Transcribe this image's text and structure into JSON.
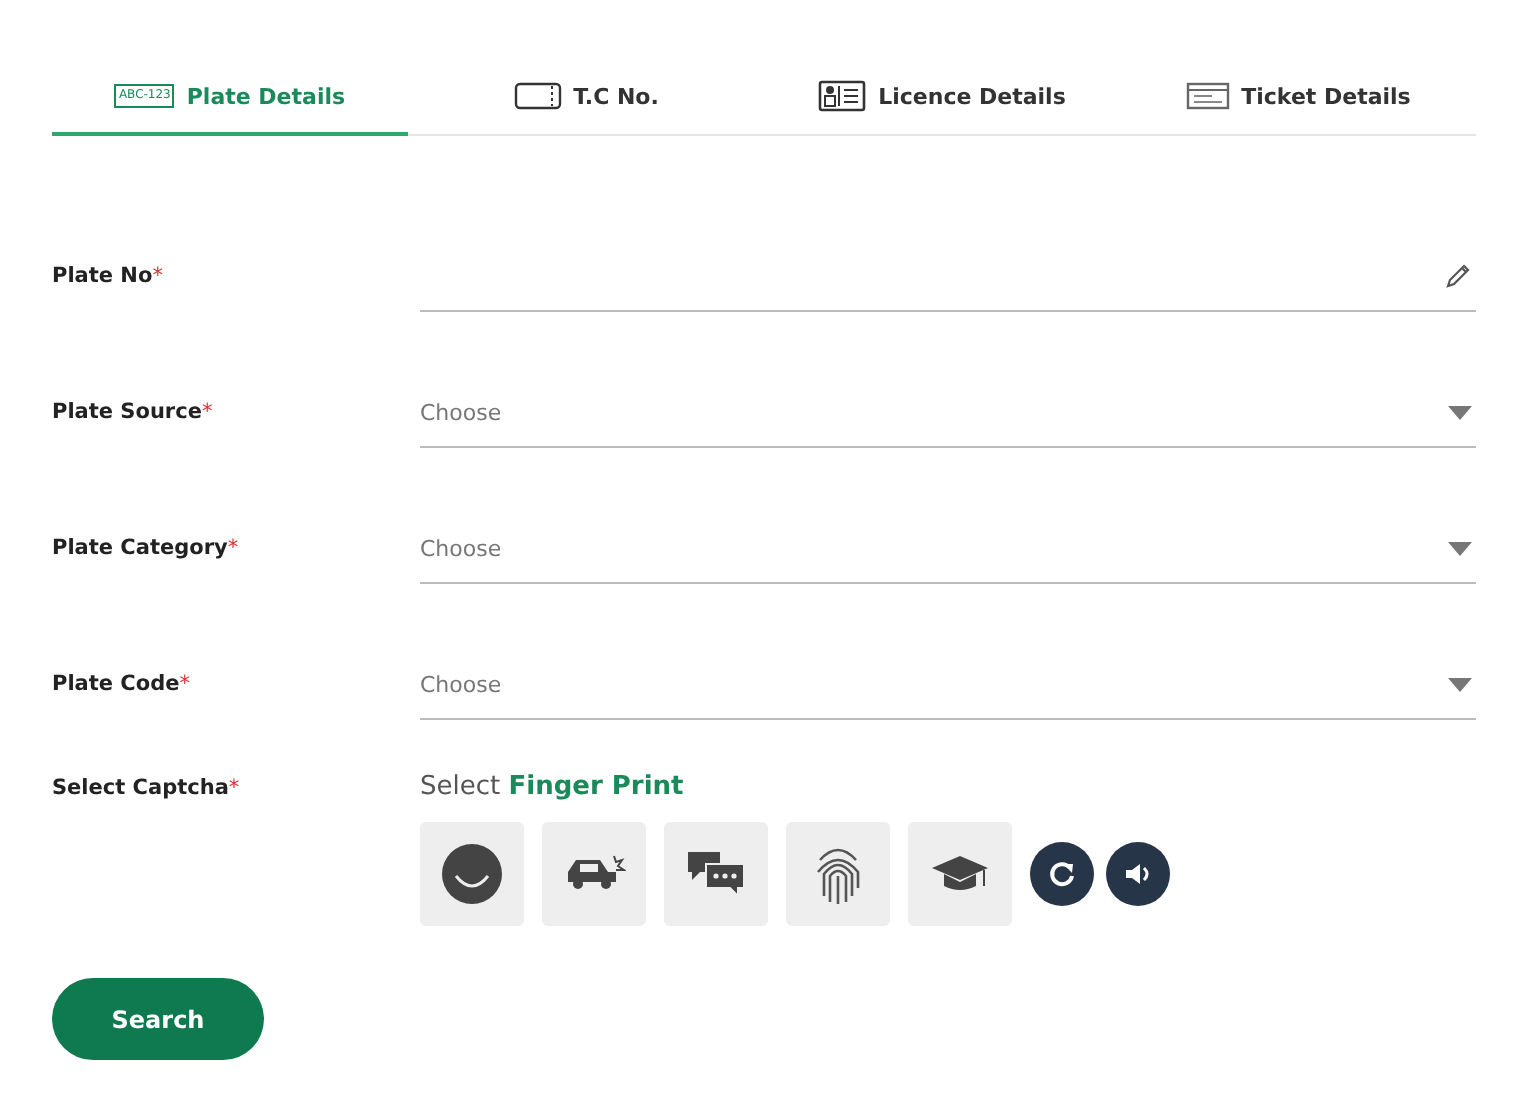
{
  "tabs": [
    {
      "kind": "plate",
      "icon_text": "ABC-123",
      "label": "Plate Details",
      "selected": true
    },
    {
      "kind": "card",
      "label": "T.C No.",
      "selected": false
    },
    {
      "kind": "licence",
      "label": "Licence Details",
      "selected": false
    },
    {
      "kind": "ticket",
      "label": "Ticket Details",
      "selected": false
    }
  ],
  "fields": [
    {
      "kind": "text",
      "label": "Plate No",
      "required_mark": "*"
    },
    {
      "kind": "select",
      "label": "Plate Source",
      "required_mark": "*",
      "placeholder": "Choose"
    },
    {
      "kind": "select",
      "label": "Plate Category",
      "required_mark": "*",
      "placeholder": "Choose"
    },
    {
      "kind": "select",
      "label": "Plate Code",
      "required_mark": "*",
      "placeholder": "Choose"
    }
  ],
  "captcha": {
    "label": "Select Captcha",
    "required_mark": "*",
    "prompt": "Select",
    "target": "Finger Print",
    "options": [
      {
        "kind": "smiley",
        "selected": false
      },
      {
        "kind": "car",
        "selected": false
      },
      {
        "kind": "chat",
        "selected": false
      },
      {
        "kind": "fingerprint",
        "selected": false
      },
      {
        "kind": "cap",
        "selected": false
      }
    ]
  },
  "search_button": "Search"
}
